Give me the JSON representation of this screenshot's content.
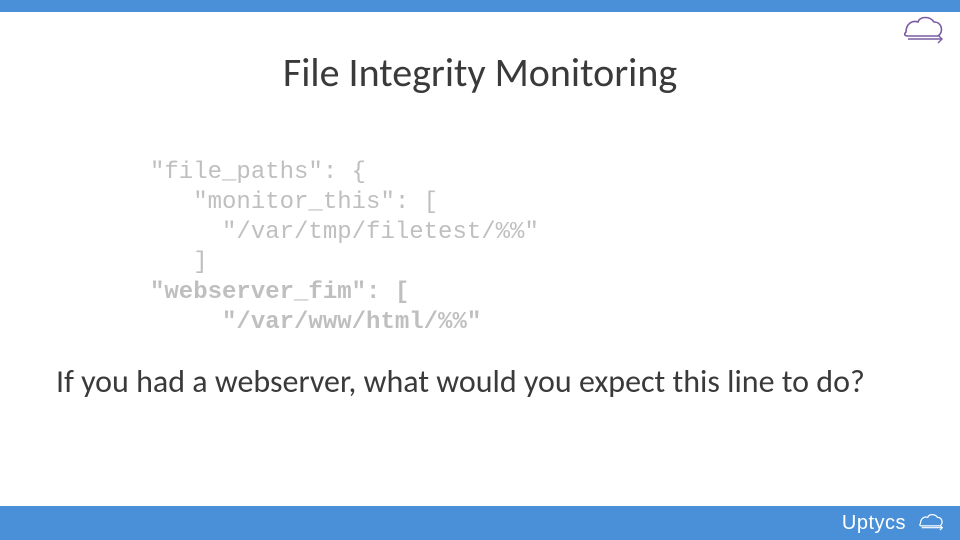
{
  "title": "File Integrity Monitoring",
  "code": {
    "l1": "\"file_paths\": {",
    "l2": "   \"monitor_this\": [",
    "l3": "     \"/var/tmp/filetest/%%\"",
    "l4": "   ]",
    "l5": "\"webserver_fim\": [",
    "l6": "     \"/var/www/html/%%\""
  },
  "question": "If you had a webserver, what would you expect this line to do?",
  "brand": "Uptycs",
  "colors": {
    "accent_blue": "#4a90d9",
    "code_gray": "#bfbfbf",
    "logo_purple": "#7a5ca0"
  },
  "icons": {
    "cloud": "cloud-arrow-icon"
  }
}
